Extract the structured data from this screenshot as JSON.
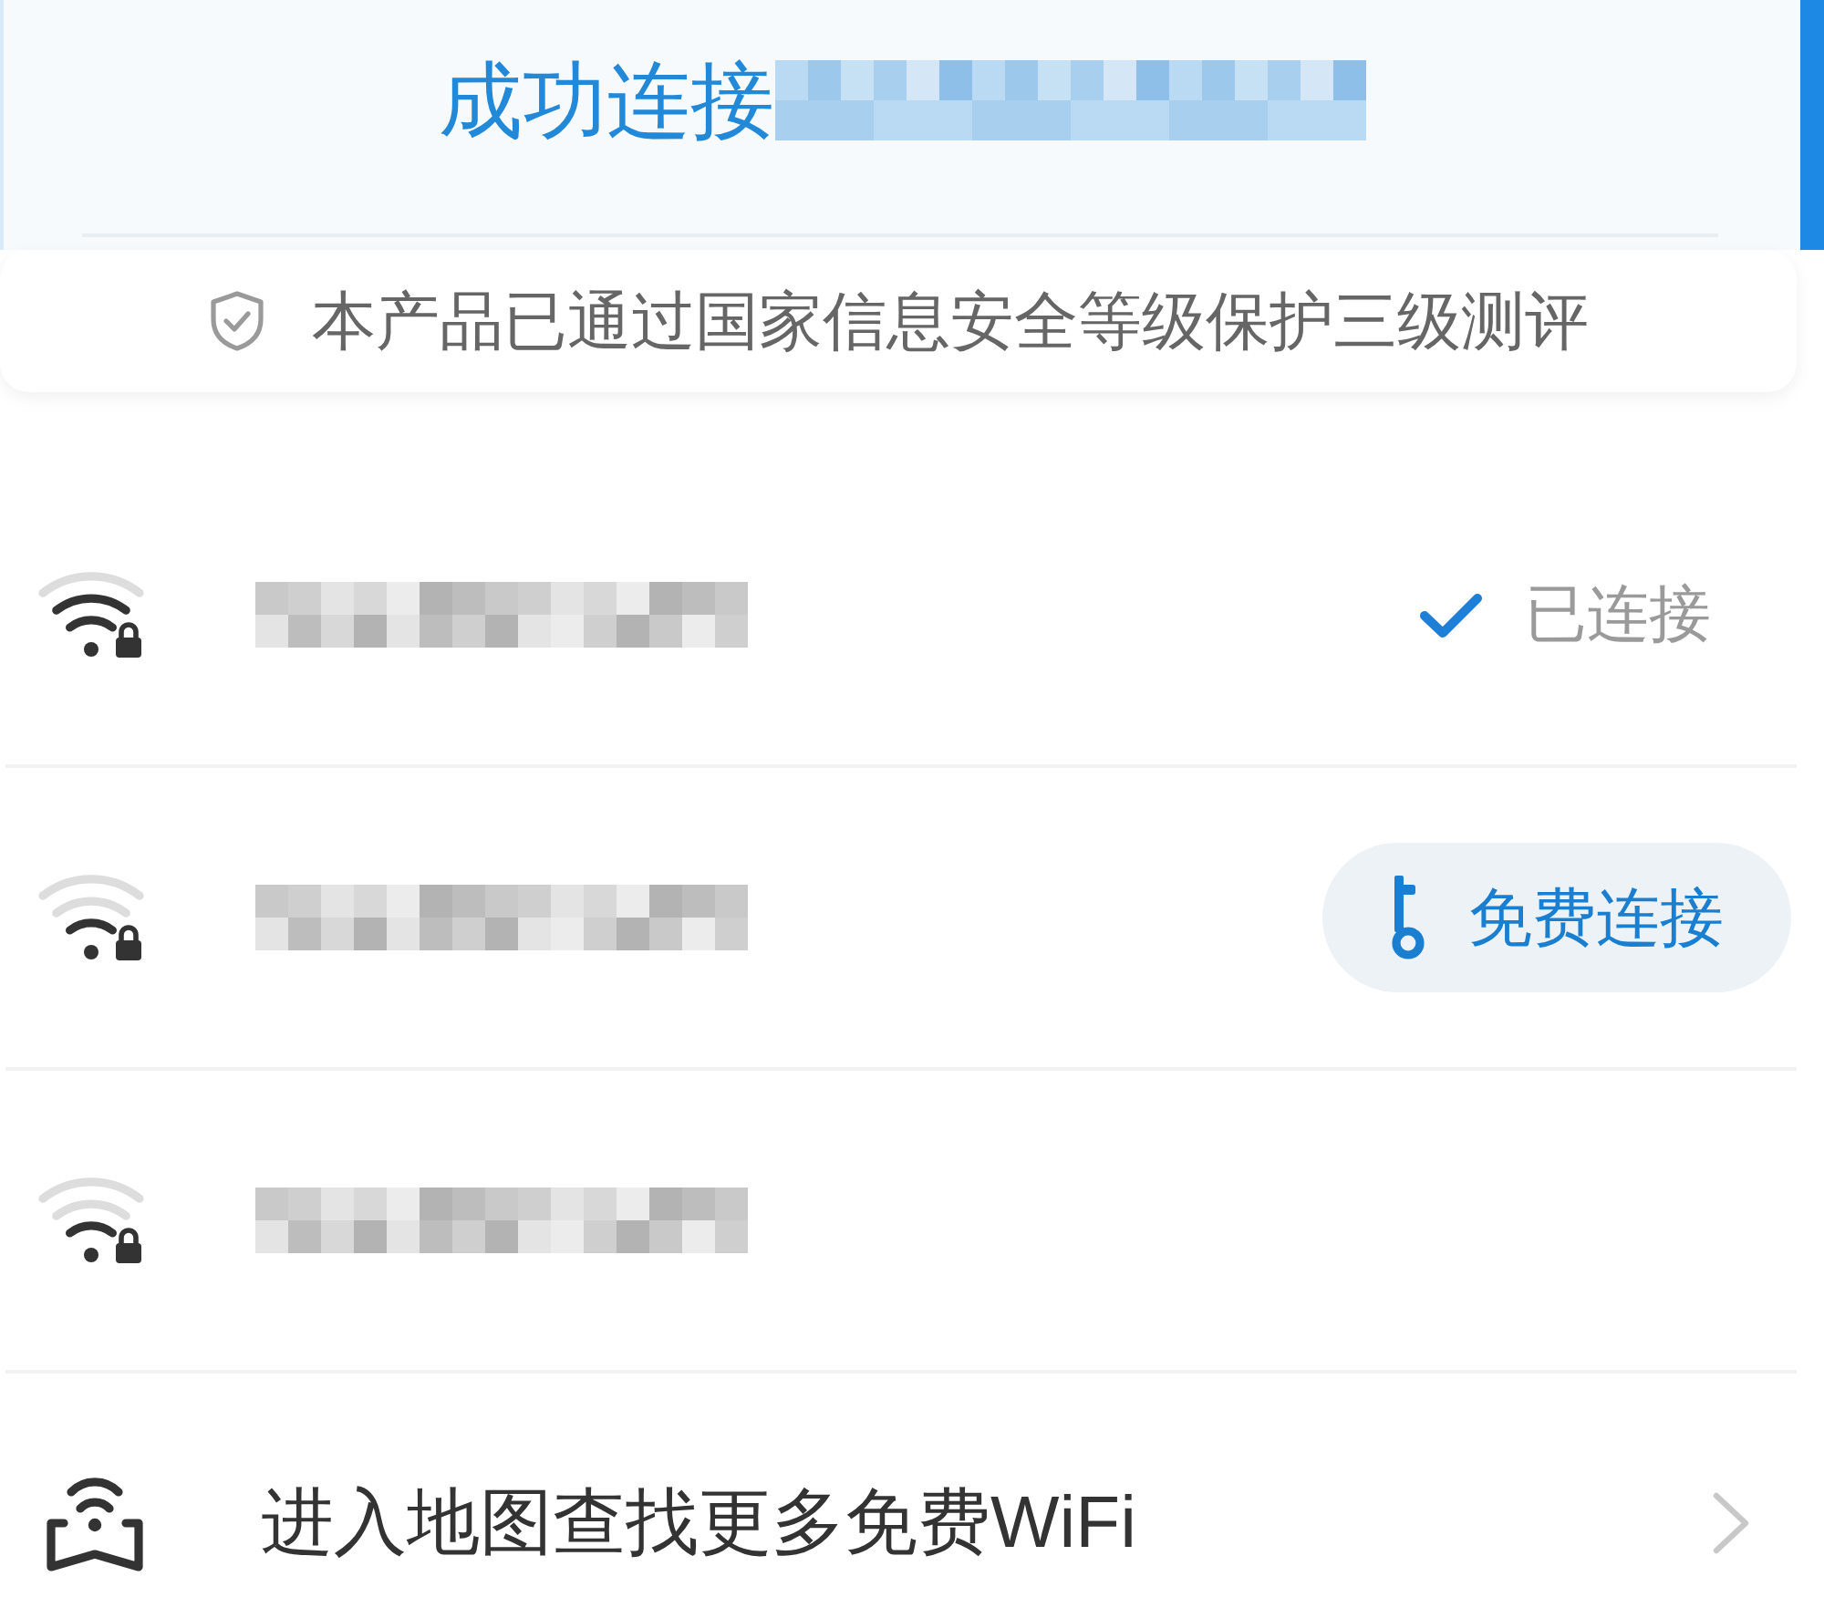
{
  "header": {
    "title": "成功连接",
    "notice": "本产品已通过国家信息安全等级保护三级测评"
  },
  "networks": [
    {
      "kind": "connected",
      "strong_signal": true,
      "locked": true,
      "status": "已连接"
    },
    {
      "kind": "free",
      "strong_signal": false,
      "locked": true,
      "action": "免费连接"
    },
    {
      "kind": "plain",
      "strong_signal": false,
      "locked": true
    }
  ],
  "map_entry": {
    "label": "进入地图查找更多免费WiFi"
  }
}
